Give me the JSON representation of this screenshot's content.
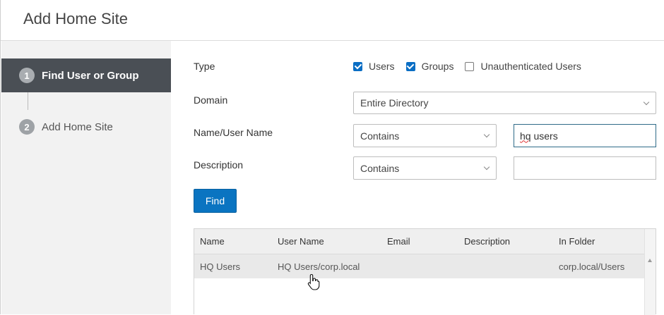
{
  "dialog": {
    "title": "Add Home Site"
  },
  "steps": [
    {
      "number": "1",
      "label": "Find User or Group",
      "active": true
    },
    {
      "number": "2",
      "label": "Add Home Site",
      "active": false
    }
  ],
  "form": {
    "type_label": "Type",
    "types": [
      {
        "label": "Users",
        "checked": true
      },
      {
        "label": "Groups",
        "checked": true
      },
      {
        "label": "Unauthenticated Users",
        "checked": false
      }
    ],
    "domain_label": "Domain",
    "domain_value": "Entire Directory",
    "name_label": "Name/User Name",
    "name_operator": "Contains",
    "name_value_a": "hq",
    "name_value_b": " users",
    "description_label": "Description",
    "description_operator": "Contains",
    "description_value": ""
  },
  "find_button": "Find",
  "results": {
    "columns": [
      "Name",
      "User Name",
      "Email",
      "Description",
      "In Folder"
    ],
    "rows": [
      [
        "HQ Users",
        "HQ Users/corp.local",
        "",
        "",
        "corp.local/Users"
      ]
    ]
  },
  "colors": {
    "accent": "#0a74c1",
    "sidebar_active": "#4a4f55"
  }
}
